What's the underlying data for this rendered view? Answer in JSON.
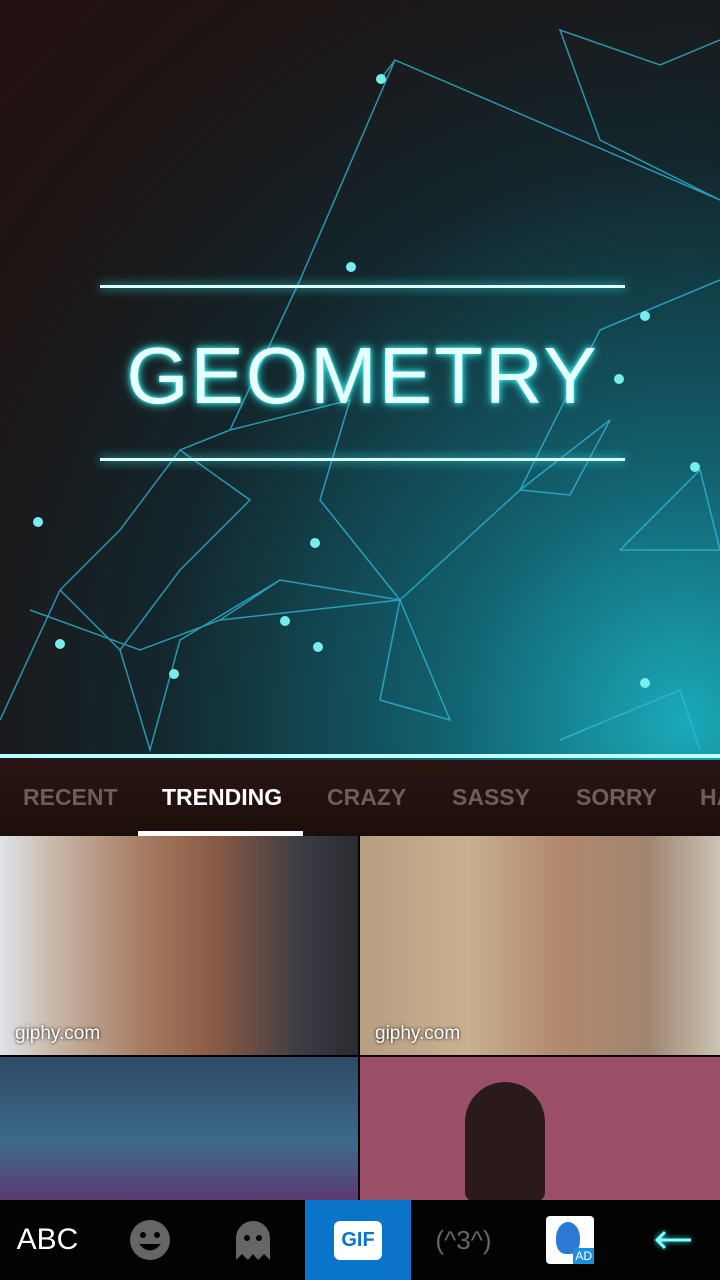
{
  "theme": {
    "title": "GEOMETRY",
    "accent": "#3ee6e6"
  },
  "tabs": [
    {
      "label": "RECENT"
    },
    {
      "label": "TRENDING",
      "active": true
    },
    {
      "label": "CRAZY"
    },
    {
      "label": "SASSY"
    },
    {
      "label": "SORRY"
    },
    {
      "label": "HA"
    }
  ],
  "gifs": [
    {
      "source": "giphy.com"
    },
    {
      "source": "giphy.com"
    },
    {
      "source": ""
    },
    {
      "source": ""
    }
  ],
  "bottom_bar": {
    "abc_label": "ABC",
    "gif_label": "GIF",
    "kaomoji_label": "(^3^)",
    "ad_label": "AD",
    "selected": "gif",
    "selected_color": "#0a74c8"
  }
}
